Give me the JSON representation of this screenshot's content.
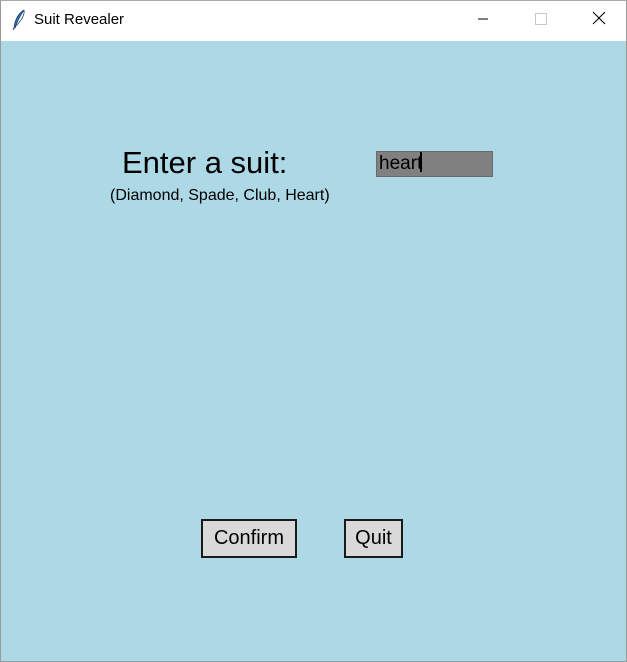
{
  "window": {
    "title": "Suit Revealer",
    "app_icon": "feather-icon",
    "controls": {
      "minimize_icon": "minimize-icon",
      "maximize_icon": "maximize-icon",
      "close_icon": "close-icon"
    }
  },
  "form": {
    "prompt": "Enter a suit:",
    "hint": "(Diamond, Spade, Club, Heart)",
    "suit_value": "heart"
  },
  "buttons": {
    "confirm_label": "Confirm",
    "quit_label": "Quit"
  },
  "colors": {
    "background": "#add8e6",
    "entry_background": "#808080",
    "button_background": "#d9d9d9"
  }
}
